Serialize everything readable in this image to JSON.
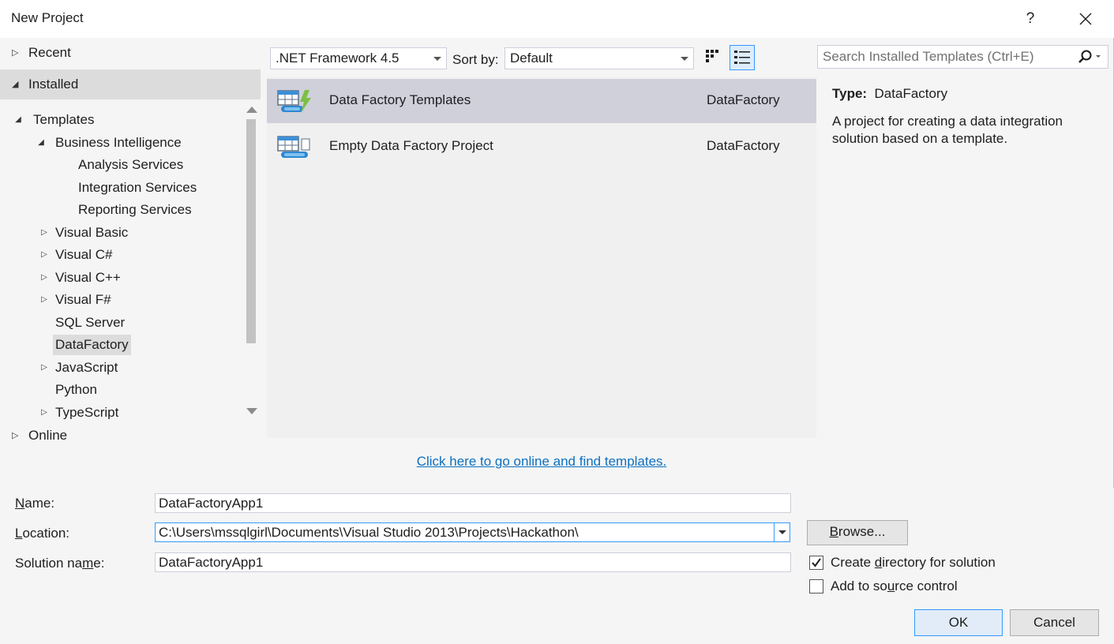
{
  "window": {
    "title": "New Project",
    "help_label": "?"
  },
  "sections": {
    "recent": "Recent",
    "installed": "Installed",
    "online": "Online"
  },
  "tree": [
    {
      "label": "Templates",
      "arrow": "◢"
    },
    {
      "label": "Business Intelligence",
      "arrow": "◢"
    },
    {
      "label": "Analysis Services",
      "arrow": ""
    },
    {
      "label": "Integration Services",
      "arrow": ""
    },
    {
      "label": "Reporting Services",
      "arrow": ""
    },
    {
      "label": "Visual Basic",
      "arrow": "▷"
    },
    {
      "label": "Visual C#",
      "arrow": "▷"
    },
    {
      "label": "Visual C++",
      "arrow": "▷"
    },
    {
      "label": "Visual F#",
      "arrow": "▷"
    },
    {
      "label": "SQL Server",
      "arrow": ""
    },
    {
      "label": "DataFactory",
      "arrow": "",
      "selected": true
    },
    {
      "label": "JavaScript",
      "arrow": "▷"
    },
    {
      "label": "Python",
      "arrow": ""
    },
    {
      "label": "TypeScript",
      "arrow": "▷"
    }
  ],
  "toolbar": {
    "framework": ".NET Framework 4.5",
    "sort_label": "Sort by:",
    "sort_value": "Default",
    "search_placeholder": "Search Installed Templates (Ctrl+E)"
  },
  "templates": [
    {
      "name": "Data Factory Templates",
      "type": "DataFactory",
      "icon": "data-factory-templates-icon",
      "selected": true
    },
    {
      "name": "Empty Data Factory Project",
      "type": "DataFactory",
      "icon": "empty-data-factory-icon",
      "selected": false
    }
  ],
  "online_link": "Click here to go online and find templates.",
  "details": {
    "type_label": "Type:",
    "type_value": "DataFactory",
    "description": "A project for creating a data integration solution based on a template."
  },
  "form": {
    "name_label_pre": "",
    "name_label_key": "N",
    "name_label_post": "ame:",
    "name_value": "DataFactoryApp1",
    "location_label_pre": "",
    "location_label_key": "L",
    "location_label_post": "ocation:",
    "location_value": "C:\\Users\\mssqlgirl\\Documents\\Visual Studio 2013\\Projects\\Hackathon\\",
    "solution_label_pre": "Solution na",
    "solution_label_key": "m",
    "solution_label_post": "e:",
    "solution_value": "DataFactoryApp1",
    "browse_key": "B",
    "browse_rest": "rowse...",
    "create_dir_pre": "Create ",
    "create_dir_key": "d",
    "create_dir_post": "irectory for solution",
    "create_dir_checked": true,
    "source_pre": "Add to so",
    "source_key": "u",
    "source_post": "rce control",
    "source_checked": false,
    "ok_label": "OK",
    "cancel_label": "Cancel"
  },
  "colors": {
    "accent": "#3399ff",
    "selection": "#cfd0da",
    "link": "#0e70c0",
    "window_border": "#e8c07a"
  }
}
